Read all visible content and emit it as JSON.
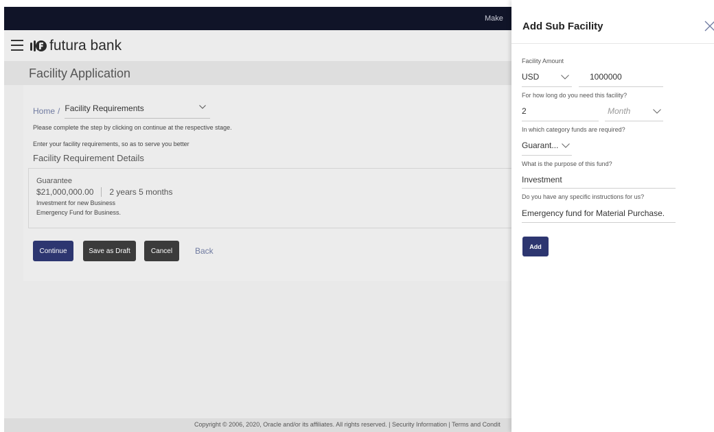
{
  "topbar": {
    "text": "Make"
  },
  "brand": {
    "name": "futura bank"
  },
  "page": {
    "title": "Facility Application"
  },
  "breadcrumb": {
    "home": "Home",
    "separator": "/",
    "current": "Facility Requirements"
  },
  "instructions": {
    "line1": "Please complete the step by clicking on continue at the respective stage.",
    "line2": "Enter your facility requirements, so as to serve you better"
  },
  "section": {
    "heading": "Facility Requirement Details"
  },
  "requirement": {
    "type": "Guarantee",
    "amount": "$21,000,000.00",
    "duration": "2 years 5 months",
    "line1": "Investment for new Business",
    "line2": "Emergency Fund for Business."
  },
  "buttons": {
    "continue": "Continue",
    "save_draft": "Save as Draft",
    "cancel": "Cancel",
    "back": "Back"
  },
  "footer": {
    "text": "Copyright © 2006, 2020, Oracle and/or its affiliates. All rights reserved. | Security Information | Terms and Condit"
  },
  "panel": {
    "title": "Add Sub Facility",
    "facility_amount": {
      "label": "Facility Amount",
      "currency": "USD",
      "value": "1000000"
    },
    "duration": {
      "label": "For how long do you need this facility?",
      "value": "2",
      "unit_placeholder": "Month"
    },
    "category": {
      "label": "In which category funds are required?",
      "value": "Guarant..."
    },
    "purpose": {
      "label": "What is the purpose of this fund?",
      "value": "Investment"
    },
    "instructions": {
      "label": "Do you have any specific instructions for us?",
      "value": "Emergency fund for Material Purchase."
    },
    "add_button": "Add"
  },
  "colors": {
    "primary": "#2d3670",
    "dark_button": "#3b3b3b",
    "link": "#6f7aa0",
    "topbar": "#101428"
  },
  "icons": {
    "menu": "hamburger-icon",
    "close": "close-icon",
    "dropdown": "chevron-down-icon",
    "logo": "futura-logo-icon"
  }
}
